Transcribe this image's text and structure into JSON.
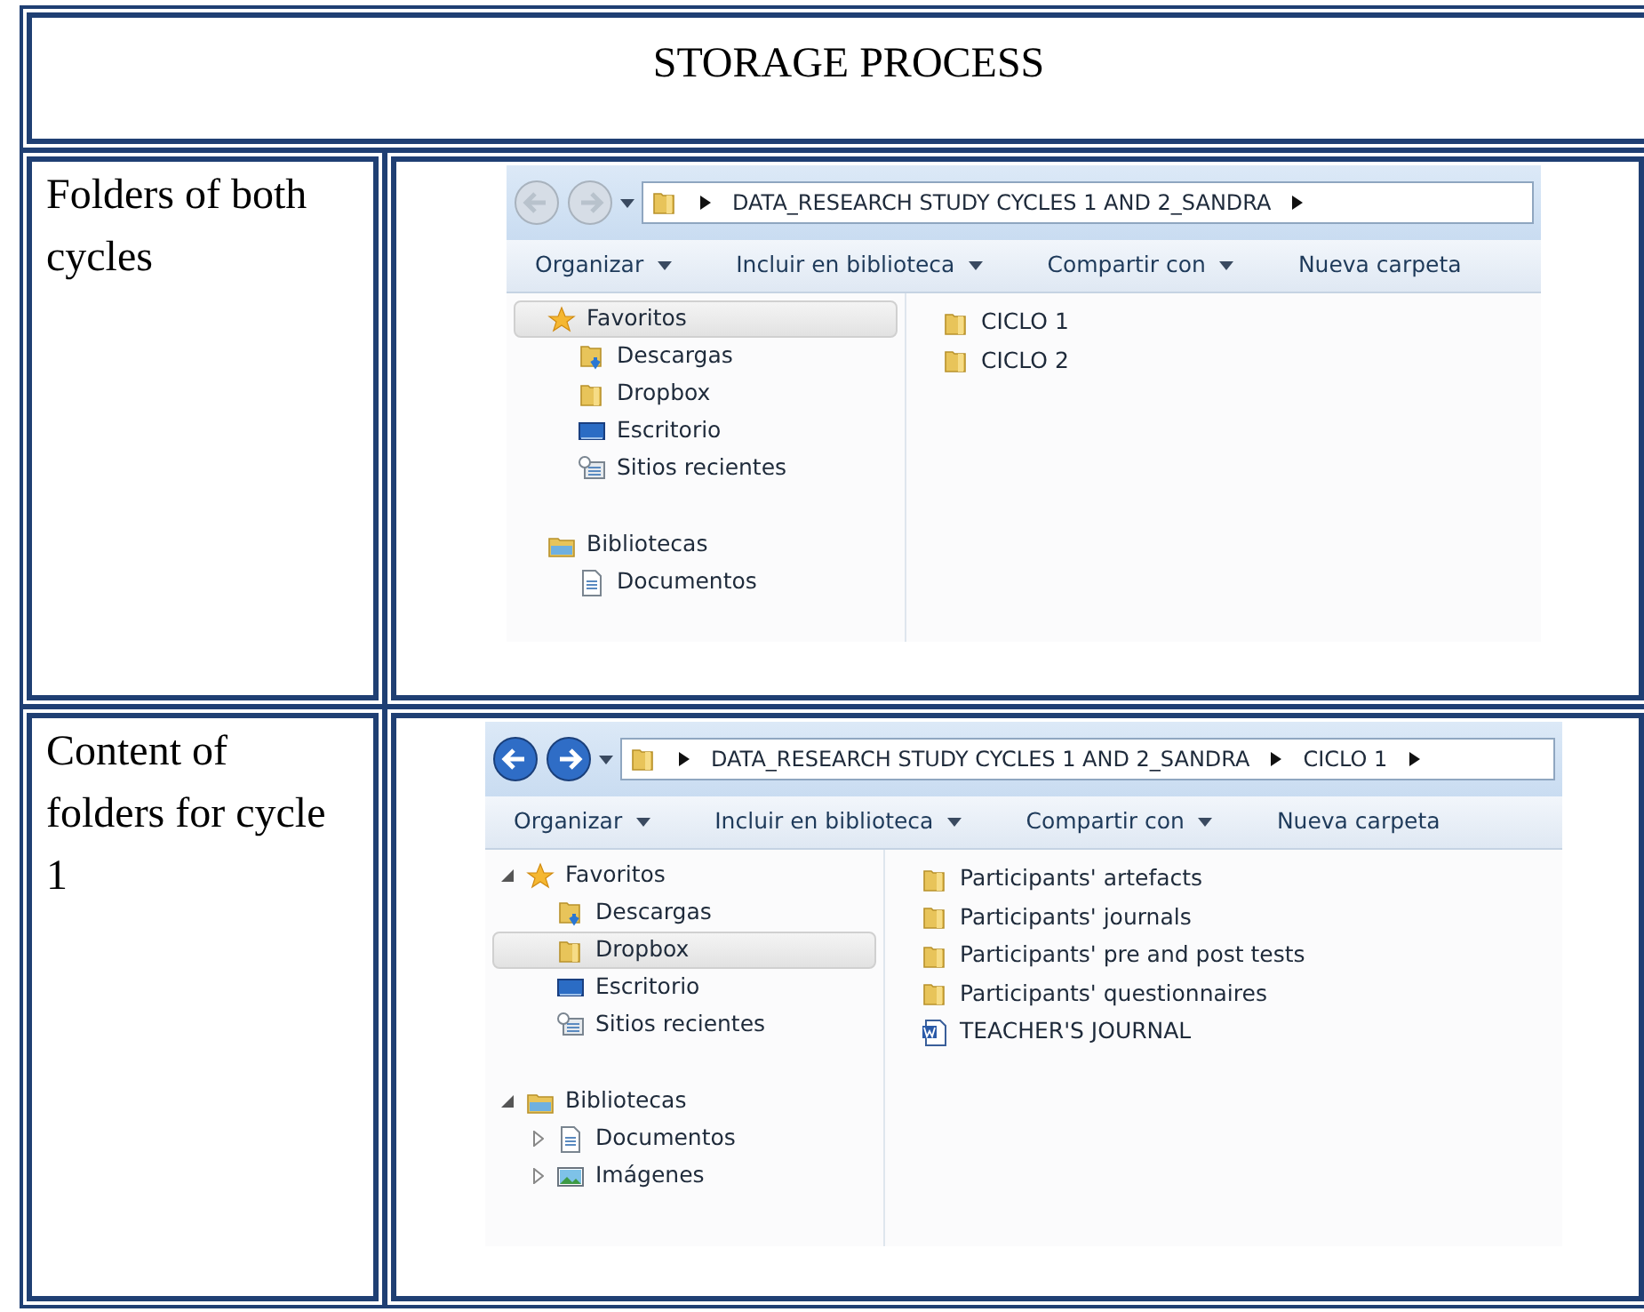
{
  "title": "STORAGE PROCESS",
  "rows": [
    {
      "label": "Folders of both cycles",
      "explorer": {
        "nav_enabled": false,
        "breadcrumb": [
          "DATA_RESEARCH STUDY CYCLES 1 AND 2_SANDRA"
        ],
        "toolbar": [
          {
            "label": "Organizar",
            "dropdown": true
          },
          {
            "label": "Incluir en biblioteca",
            "dropdown": true
          },
          {
            "label": "Compartir con",
            "dropdown": true
          },
          {
            "label": "Nueva carpeta",
            "dropdown": false
          }
        ],
        "nav": [
          {
            "label": "Favoritos",
            "kind": "star",
            "selected": true,
            "children": [
              {
                "label": "Descargas",
                "kind": "downloads",
                "selected": false
              },
              {
                "label": "Dropbox",
                "kind": "folder",
                "selected": false
              },
              {
                "label": "Escritorio",
                "kind": "desktop",
                "selected": false
              },
              {
                "label": "Sitios recientes",
                "kind": "recent",
                "selected": false
              }
            ]
          },
          {
            "label": "Bibliotecas",
            "kind": "library",
            "selected": false,
            "children": [
              {
                "label": "Documentos",
                "kind": "document",
                "selected": false
              }
            ]
          }
        ],
        "files": [
          {
            "name": "CICLO 1",
            "kind": "folder"
          },
          {
            "name": "CICLO 2",
            "kind": "folder"
          }
        ]
      }
    },
    {
      "label": "Content of folders for cycle 1",
      "explorer": {
        "nav_enabled": true,
        "breadcrumb": [
          "DATA_RESEARCH STUDY CYCLES 1 AND 2_SANDRA",
          "CICLO 1"
        ],
        "toolbar": [
          {
            "label": "Organizar",
            "dropdown": true
          },
          {
            "label": "Incluir en biblioteca",
            "dropdown": true
          },
          {
            "label": "Compartir con",
            "dropdown": true
          },
          {
            "label": "Nueva carpeta",
            "dropdown": false
          }
        ],
        "nav": [
          {
            "label": "Favoritos",
            "kind": "star",
            "selected": false,
            "expanded": true,
            "children": [
              {
                "label": "Descargas",
                "kind": "downloads",
                "selected": false
              },
              {
                "label": "Dropbox",
                "kind": "folder",
                "selected": true
              },
              {
                "label": "Escritorio",
                "kind": "desktop",
                "selected": false
              },
              {
                "label": "Sitios recientes",
                "kind": "recent",
                "selected": false
              }
            ]
          },
          {
            "label": "Bibliotecas",
            "kind": "library",
            "selected": false,
            "expanded": true,
            "children": [
              {
                "label": "Documentos",
                "kind": "document",
                "selected": false,
                "expanded": false
              },
              {
                "label": "Imágenes",
                "kind": "pictures",
                "selected": false,
                "expanded": false
              }
            ]
          }
        ],
        "files": [
          {
            "name": "Participants' artefacts",
            "kind": "folder"
          },
          {
            "name": "Participants' journals",
            "kind": "folder"
          },
          {
            "name": "Participants' pre and post tests",
            "kind": "folder"
          },
          {
            "name": "Participants' questionnaires",
            "kind": "folder"
          },
          {
            "name": "TEACHER'S JOURNAL",
            "kind": "word"
          }
        ]
      }
    }
  ]
}
